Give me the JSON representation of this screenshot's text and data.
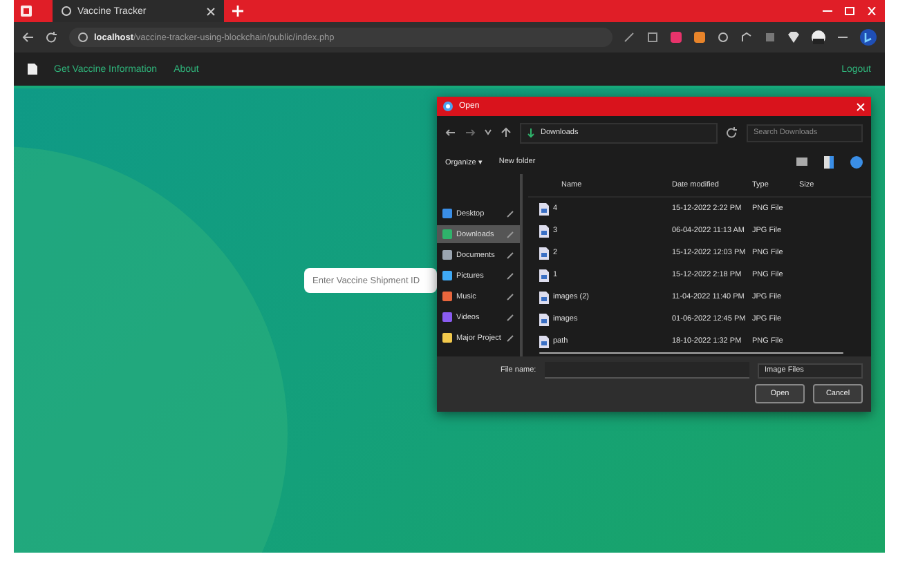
{
  "browser": {
    "tab_title": "Vaccine Tracker",
    "url_host": "localhost",
    "url_path": "/vaccine-tracker-using-blockchain/public/index.php"
  },
  "nav": {
    "links": [
      {
        "label": "Get Vaccine Information"
      },
      {
        "label": "About"
      }
    ],
    "logout": "Logout"
  },
  "shipment_field": {
    "placeholder": "Enter Vaccine Shipment ID"
  },
  "dialog": {
    "title": "Open",
    "breadcrumb": "Downloads",
    "search_placeholder": "Search Downloads",
    "organize": "Organize ▾",
    "new_folder": "New folder",
    "columns": [
      "Name",
      "Date modified",
      "Type",
      "Size"
    ],
    "sidebar": [
      {
        "label": "Desktop",
        "color": "#3a8ee6",
        "selected": false
      },
      {
        "label": "Downloads",
        "color": "#2fb36b",
        "selected": true
      },
      {
        "label": "Documents",
        "color": "#9aa4b0",
        "selected": false
      },
      {
        "label": "Pictures",
        "color": "#3fa9f5",
        "selected": false
      },
      {
        "label": "Music",
        "color": "#e8663d",
        "selected": false
      },
      {
        "label": "Videos",
        "color": "#8a5cf0",
        "selected": false
      },
      {
        "label": "Major Project",
        "color": "#f2c94c",
        "selected": false
      }
    ],
    "files": [
      {
        "name": "4",
        "date": "15-12-2022 2:22 PM",
        "type": "PNG File"
      },
      {
        "name": "3",
        "date": "06-04-2022 11:13 AM",
        "type": "JPG File"
      },
      {
        "name": "2",
        "date": "15-12-2022 12:03 PM",
        "type": "PNG File"
      },
      {
        "name": "1",
        "date": "15-12-2022 2:18 PM",
        "type": "PNG File"
      },
      {
        "name": "images (2)",
        "date": "11-04-2022 11:40 PM",
        "type": "JPG File"
      },
      {
        "name": "images",
        "date": "01-06-2022 12:45 PM",
        "type": "JPG File"
      },
      {
        "name": "path",
        "date": "18-10-2022 1:32 PM",
        "type": "PNG File"
      }
    ],
    "file_name_label": "File name:",
    "file_type": "Image Files",
    "open": "Open",
    "cancel": "Cancel"
  }
}
